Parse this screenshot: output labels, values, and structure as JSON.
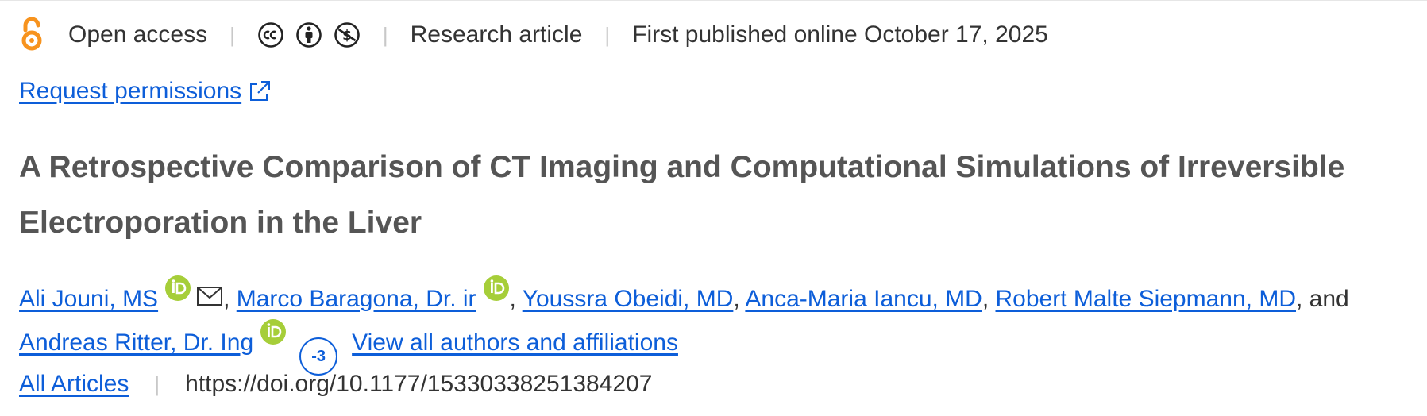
{
  "meta": {
    "open_access": "Open access",
    "article_type": "Research article",
    "published": "First published online October 17, 2025"
  },
  "icons": {
    "open_access": "open-access-lock",
    "licenses": [
      "cc",
      "by",
      "nc"
    ]
  },
  "colors": {
    "link": "#0d5ed9",
    "open_access_orange": "#f7931e",
    "orcid_green": "#a6ce39",
    "title": "#555555"
  },
  "permissions": {
    "label": "Request permissions"
  },
  "article": {
    "title": "A Retrospective Comparison of CT Imaging and Computational Simulations of Irreversible Electroporation in the Liver"
  },
  "authors": [
    {
      "name": "Ali Jouni, MS",
      "orcid": true,
      "email": true
    },
    {
      "name": "Marco Baragona, Dr. ir",
      "orcid": true,
      "email": false
    },
    {
      "name": "Youssra Obeidi, MD",
      "orcid": false,
      "email": false
    },
    {
      "name": "Anca-Maria Iancu, MD",
      "orcid": false,
      "email": false
    },
    {
      "name": "Robert Malte Siepmann, MD",
      "orcid": false,
      "email": false
    },
    {
      "name": "Andreas Ritter, Dr. Ing",
      "orcid": true,
      "email": false
    }
  ],
  "authors_conjunction": ", and",
  "more_authors_badge": "-3",
  "view_all_label": "View all authors and affiliations",
  "footer": {
    "all_articles": "All Articles",
    "doi": "https://doi.org/10.1177/15330338251384207"
  }
}
